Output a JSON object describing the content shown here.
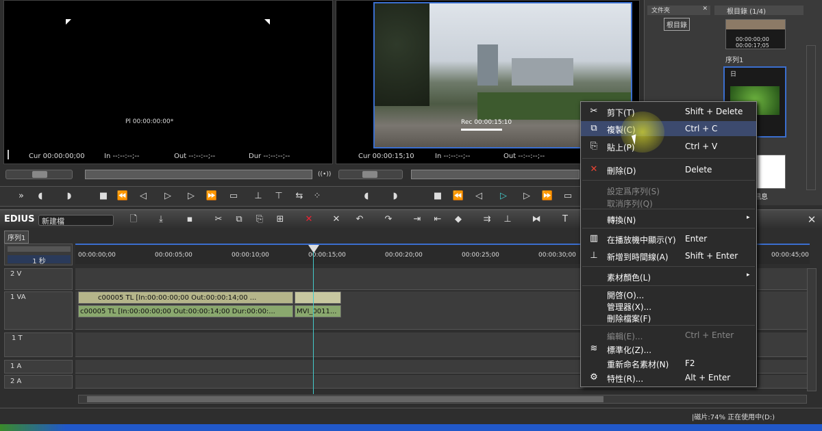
{
  "player": {
    "tc": "Pl 00:00:00:00*",
    "cur": "Cur 00:00:00;00",
    "in": "In --:--:--;--",
    "out": "Out --:--:--;--",
    "dur": "Dur --:--:--;--"
  },
  "recorder": {
    "tc": "Rec 00:00:15:10",
    "cur": "Cur 00:00:15;10",
    "in": "In --:--:--;--",
    "out": "Out --:--:--;--"
  },
  "bin": {
    "folder_tab": "文件夾",
    "root_tab": "根目錄 (1/4)",
    "tree_item": "根目錄",
    "clip1_tc1": "00:00:00;00",
    "clip1_tc2": "00:00:17;05",
    "seq_label": "序列1",
    "clip2_label": "日",
    "info_tab": "訊息"
  },
  "timeline": {
    "app": "EDIUS",
    "project": "新建檔",
    "seq_tab": "序列1",
    "scale": "1 秒",
    "ruler": [
      "00:00:00;00",
      "00:00:05;00",
      "00:00:10;00",
      "00:00:15;00",
      "00:00:20;00",
      "00:00:25;00",
      "00:00:30;00",
      "00:00:45;00"
    ],
    "tracks": [
      "2 V",
      "1 VA",
      "1 T",
      "1 A",
      "2 A"
    ],
    "clip_video": "c00005  TL [In:00:00:00;00 Out:00:00:14;00 ...",
    "clip_audio": "c00005  TL [In:00:00:00;00 Out:00:00:14;00 Dur:00:00:...",
    "clip_audio2": "MVI_0011..."
  },
  "menu": {
    "items": [
      {
        "label": "剪下(T)",
        "shortcut": "Shift + Delete",
        "icon": "cut-icon"
      },
      {
        "label": "複製(C)",
        "shortcut": "Ctrl + C",
        "icon": "copy-icon"
      },
      {
        "label": "貼上(P)",
        "shortcut": "Ctrl + V",
        "icon": "paste-icon"
      },
      {
        "label": "刪除(D)",
        "shortcut": "Delete",
        "icon": "delete-icon"
      },
      {
        "label": "設定爲序列(S)",
        "shortcut": ""
      },
      {
        "label": "取消序列(Q)",
        "shortcut": ""
      },
      {
        "label": "轉換(N)",
        "shortcut": ""
      },
      {
        "label": "在播放機中顯示(Y)",
        "shortcut": "Enter"
      },
      {
        "label": "新增到時間線(A)",
        "shortcut": "Shift + Enter"
      },
      {
        "label": "素材顏色(L)",
        "shortcut": ""
      },
      {
        "label": "開啓(O)...",
        "shortcut": ""
      },
      {
        "label": "管理器(X)...",
        "shortcut": ""
      },
      {
        "label": "刪除檔案(F)",
        "shortcut": ""
      },
      {
        "label": "編輯(E)...",
        "shortcut": "Ctrl + Enter"
      },
      {
        "label": "標準化(Z)...",
        "shortcut": ""
      },
      {
        "label": "重新命名素材(N)",
        "shortcut": "F2"
      },
      {
        "label": "特性(R)...",
        "shortcut": "Alt + Enter"
      }
    ]
  },
  "status": {
    "text": "|磁片:74% 正在使用中(D:)"
  },
  "colors": {
    "video_clip": "#b5b58a",
    "audio_clip": "#8aa86e",
    "highlight": "#c8c81e",
    "cursor_line": "#4cc",
    "accent": "#4a7fd4"
  }
}
